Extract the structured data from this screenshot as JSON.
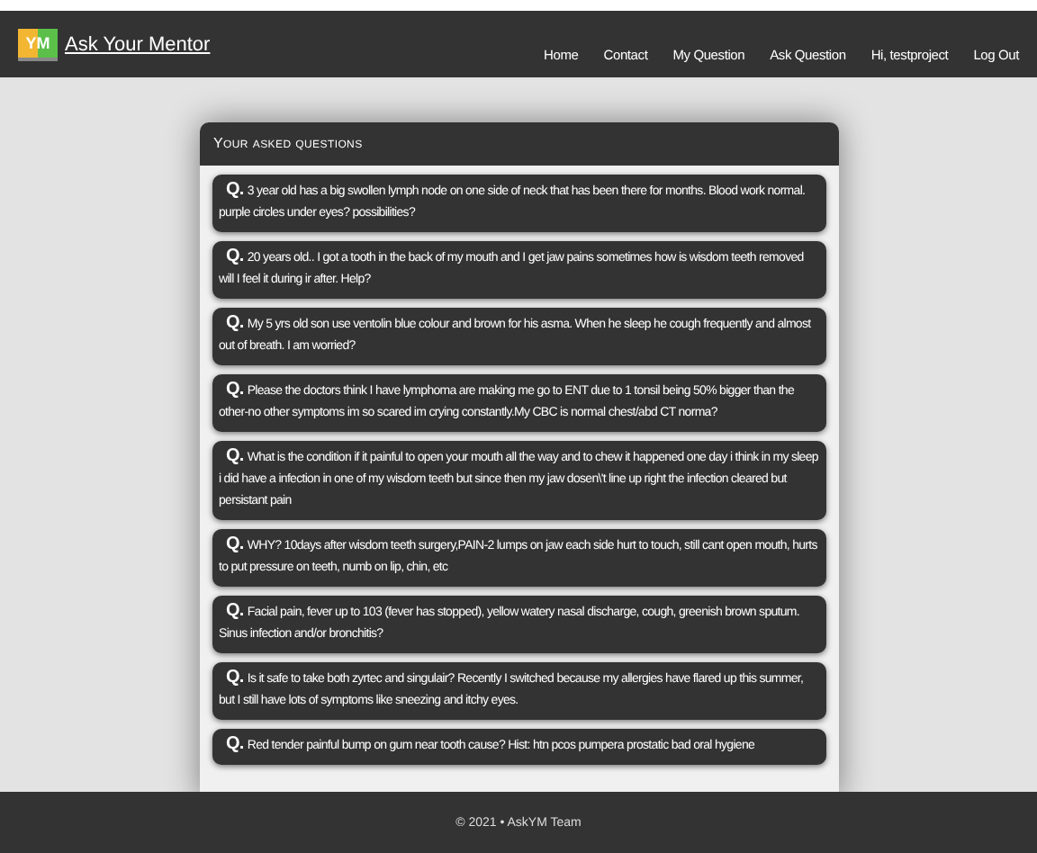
{
  "brand": {
    "logo": "YM",
    "name": "Ask Your Mentor"
  },
  "nav": [
    "Home",
    "Contact",
    "My Question",
    "Ask Question",
    "Hi, testproject",
    "Log Out"
  ],
  "card": {
    "title": "Your asked questions"
  },
  "questions": [
    {
      "prefix": "Q.",
      "text": "3 year old has a big swollen lymph node on one side of neck that has been there for months. Blood work normal. purple circles under eyes? possibilities?"
    },
    {
      "prefix": "Q.",
      "text": "20 years old.. I got a tooth in the back of my mouth and I get jaw pains sometimes how is wisdom teeth removed will I feel it during ir after. Help?"
    },
    {
      "prefix": "Q.",
      "text": "My 5 yrs old son use ventolin blue colour and brown for his asma. When he sleep he cough frequently and almost out of breath. I am worried?"
    },
    {
      "prefix": "Q.",
      "text": "Please the doctors think I have lymphoma are making me go to ENT due to 1 tonsil being 50% bigger than the other-no other symptoms im so scared im crying constantly.My CBC is normal chest/abd CT norma?"
    },
    {
      "prefix": "Q.",
      "text": "What is the condition if it painful to open your mouth all the way and to chew it happened one day i think in my sleep i did have a infection in one of my wisdom teeth but since then my jaw dosen\\'t line up right the infection cleared but persistant pain"
    },
    {
      "prefix": "Q.",
      "text": "WHY? 10days after wisdom teeth surgery,PAIN-2 lumps on jaw each side hurt to touch, still cant open mouth, hurts to put pressure on teeth, numb on lip, chin, etc"
    },
    {
      "prefix": "Q.",
      "text": "Facial pain, fever up to 103 (fever has stopped), yellow watery nasal discharge, cough, greenish brown sputum. Sinus infection and/or bronchitis?"
    },
    {
      "prefix": "Q.",
      "text": "Is it safe to take both zyrtec and singulair? Recently I switched because my allergies have flared up this summer, but I still have lots of symptoms like sneezing and itchy eyes."
    },
    {
      "prefix": "Q.",
      "text": "Red tender painful bump on gum near tooth cause? Hist: htn pcos pumpera prostatic bad oral hygiene"
    }
  ],
  "footer": "© 2021 • AskYM Team"
}
